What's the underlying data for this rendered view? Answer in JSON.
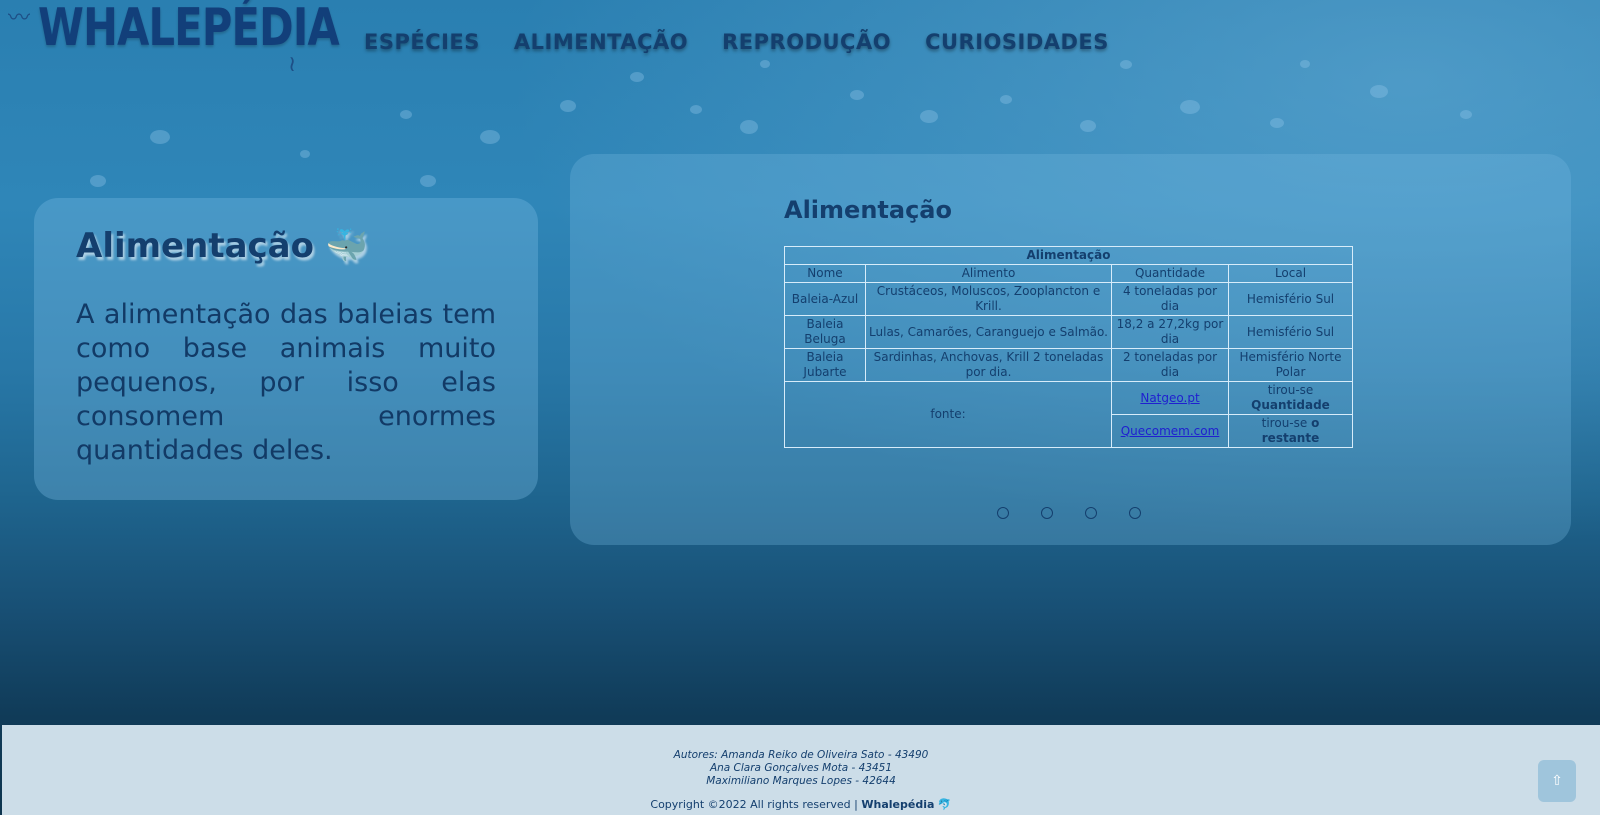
{
  "header": {
    "logo": "WHALEPÉDIA",
    "nav": [
      "ESPÉCIES",
      "ALIMENTAÇÃO",
      "REPRODUÇÃO",
      "CURIOSIDADES"
    ]
  },
  "intro": {
    "title": "Alimentação 🐳",
    "text": "A alimentação das baleias tem como base animais muito pequenos, por isso elas consomem enormes quantidades deles."
  },
  "carousel": {
    "title": "Alimentação",
    "table": {
      "caption": "Alimentação",
      "headers": [
        "Nome",
        "Alimento",
        "Quantidade",
        "Local"
      ],
      "rows": [
        [
          "Baleia-Azul",
          "Crustáceos, Moluscos, Zooplancton e Krill.",
          "4 toneladas por dia",
          "Hemisfério Sul"
        ],
        [
          "Baleia Beluga",
          "Lulas, Camarões, Caranguejo e Salmão.",
          "18,2 a 27,2kg por dia",
          "Hemisfério Sul"
        ],
        [
          "Baleia Jubarte",
          "Sardinhas, Anchovas, Krill 2 toneladas por dia.",
          "2 toneladas por dia",
          "Hemisfério Norte Polar"
        ]
      ],
      "source_label": "fonte:",
      "sources": [
        {
          "link": "Natgeo.pt",
          "note_prefix": "tirou-se",
          "note_bold": "Quantidade"
        },
        {
          "link": "Quecomem.com",
          "note_prefix": "tirou-se",
          "note_bold": "o restante"
        }
      ]
    },
    "dots": 4
  },
  "footer": {
    "authors": [
      "Autores: Amanda Reiko de Oliveira Sato - 43490",
      "Ana Clara Gonçalves Mota - 43451",
      "Maximiliano Marques Lopes - 42644"
    ],
    "copyright": "Copyright ©2022 All rights reserved |",
    "brand": "Whalepédia",
    "brand_icon": "🐬"
  },
  "back_to_top": "⇧",
  "colors": {
    "accent": "#143f6e",
    "footer_bg": "#ccdde8"
  }
}
